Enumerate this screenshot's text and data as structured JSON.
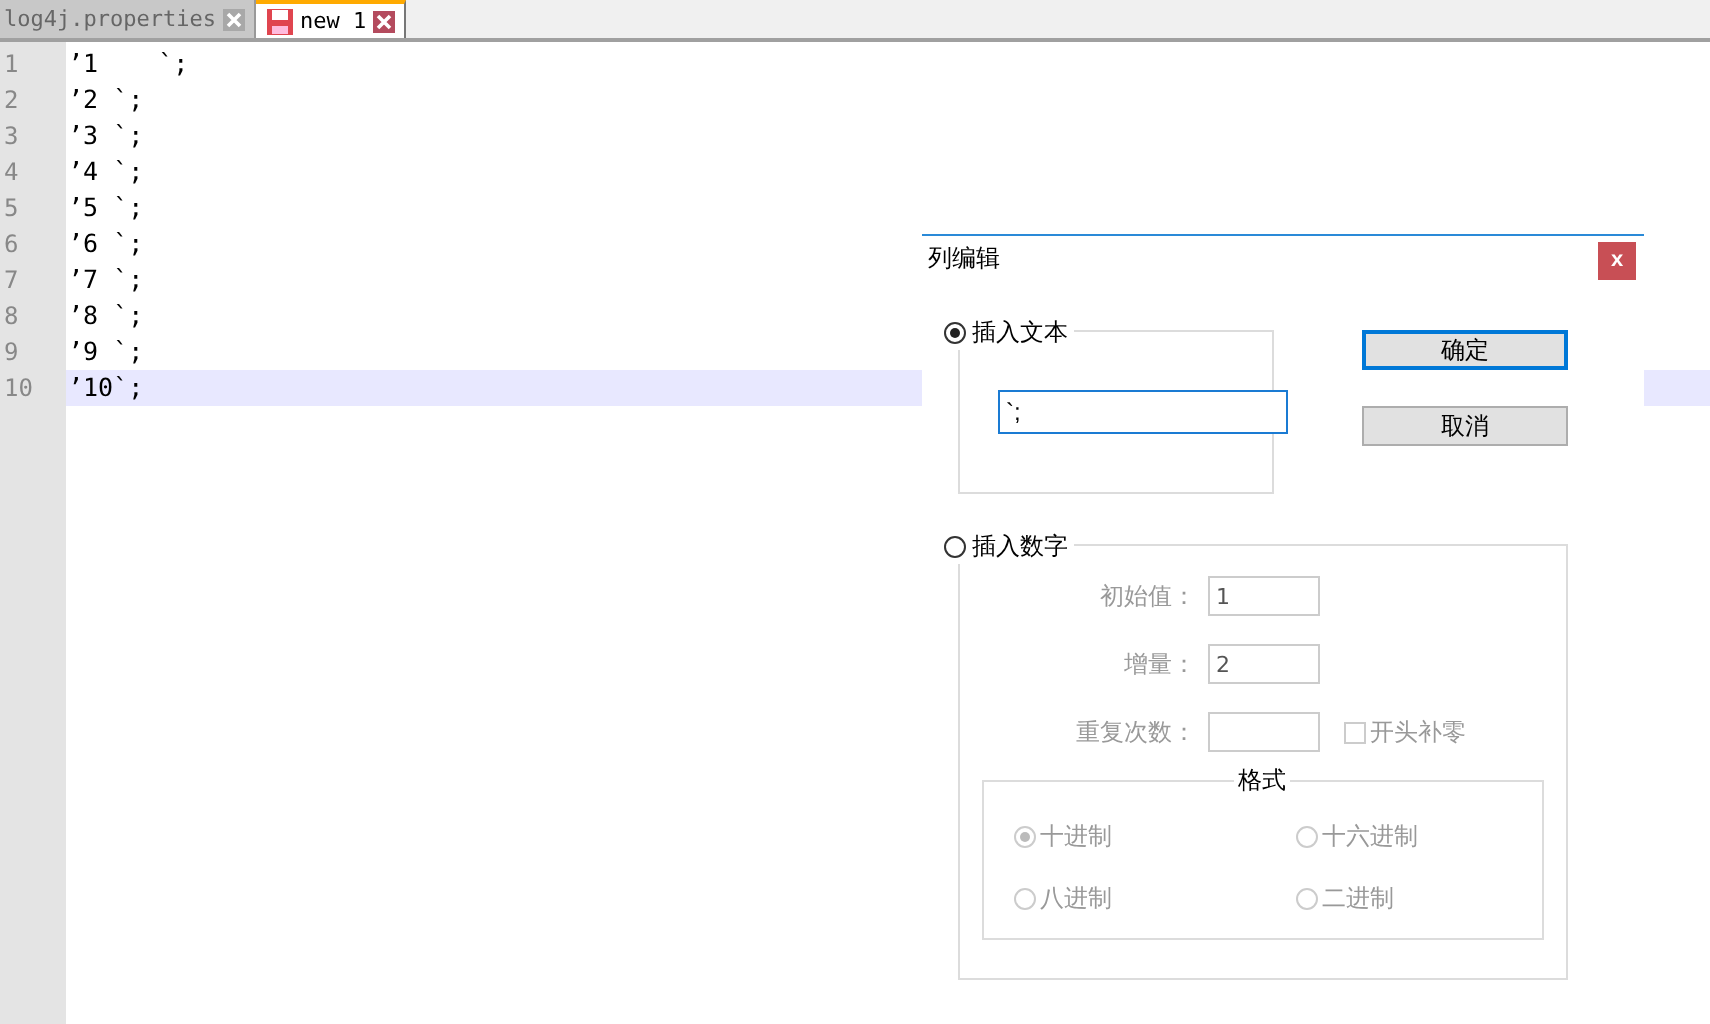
{
  "tabs": [
    {
      "label": "log4j.properties",
      "selected": false,
      "modified": false
    },
    {
      "label": "new 1",
      "selected": true,
      "modified": true
    }
  ],
  "lines": [
    {
      "number": "1",
      "text": "’1    `;",
      "current": false
    },
    {
      "number": "2",
      "text": "’2 `;",
      "current": false
    },
    {
      "number": "3",
      "text": "’3 `;",
      "current": false
    },
    {
      "number": "4",
      "text": "’4 `;",
      "current": false
    },
    {
      "number": "5",
      "text": "’5 `;",
      "current": false
    },
    {
      "number": "6",
      "text": "’6 `;",
      "current": false
    },
    {
      "number": "7",
      "text": "’7 `;",
      "current": false
    },
    {
      "number": "8",
      "text": "’8 `;",
      "current": false
    },
    {
      "number": "9",
      "text": "’9 `;",
      "current": false
    },
    {
      "number": "10",
      "text": "’10`;",
      "current": true
    }
  ],
  "dialog": {
    "title": "列编辑",
    "close": "x",
    "insert_text": {
      "label": "插入文本",
      "selected": true,
      "value": "`;"
    },
    "buttons": [
      {
        "label": "确定",
        "focused": true
      },
      {
        "label": "取消",
        "focused": false
      }
    ],
    "insert_number": {
      "label": "插入数字",
      "selected": false,
      "disabled": true,
      "fields": [
        {
          "label": "初始值：",
          "value": "1"
        },
        {
          "label": "增量：",
          "value": "2"
        },
        {
          "label": "重复次数："
        }
      ],
      "checkbox": {
        "label": "开头补零",
        "checked": false
      },
      "format": {
        "title": "格式",
        "options": [
          {
            "label": "十进制",
            "selected": true
          },
          {
            "label": "十六进制",
            "selected": false
          },
          {
            "label": "八进制",
            "selected": false
          },
          {
            "label": "二进制",
            "selected": false
          }
        ]
      }
    }
  }
}
